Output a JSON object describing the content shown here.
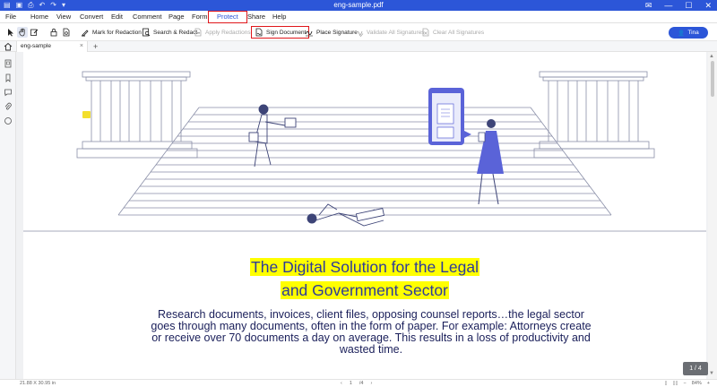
{
  "window": {
    "title": "eng-sample.pdf"
  },
  "menu": {
    "items": [
      "File",
      "Home",
      "View",
      "Convert",
      "Edit",
      "Comment",
      "Page",
      "Form",
      "Protect",
      "Share",
      "Help"
    ],
    "active": "Protect"
  },
  "toolbar": {
    "mark_redaction": "Mark for Redaction",
    "search_redact": "Search & Redact",
    "apply_redactions": "Apply Redactions",
    "sign_document": "Sign Document",
    "place_signature": "Place Signature",
    "validate_signatures": "Validate All Signatures",
    "clear_signatures": "Clear All Signatures"
  },
  "user": {
    "name": "Tina"
  },
  "tabs": [
    {
      "label": "eng-sample"
    }
  ],
  "document": {
    "headline_line1": "The Digital Solution for the Legal",
    "headline_line2": "and Government Sector",
    "body": "Research documents, invoices, client files, opposing counsel reports…the legal sector goes through many documents, often in the form of paper. For example: Attorneys create or receive over 70 documents a day on average. This results in a loss of productivity and wasted time."
  },
  "page_indicator": "1 / 4",
  "status": {
    "dimensions": "21.88 X 30.95 in",
    "page_field": "1",
    "page_total": "/4",
    "zoom": "84%"
  },
  "colors": {
    "accent": "#2c56d8",
    "highlight": "#ffff00",
    "headline": "#2d3a9a",
    "illustration": "#5a63d8"
  }
}
